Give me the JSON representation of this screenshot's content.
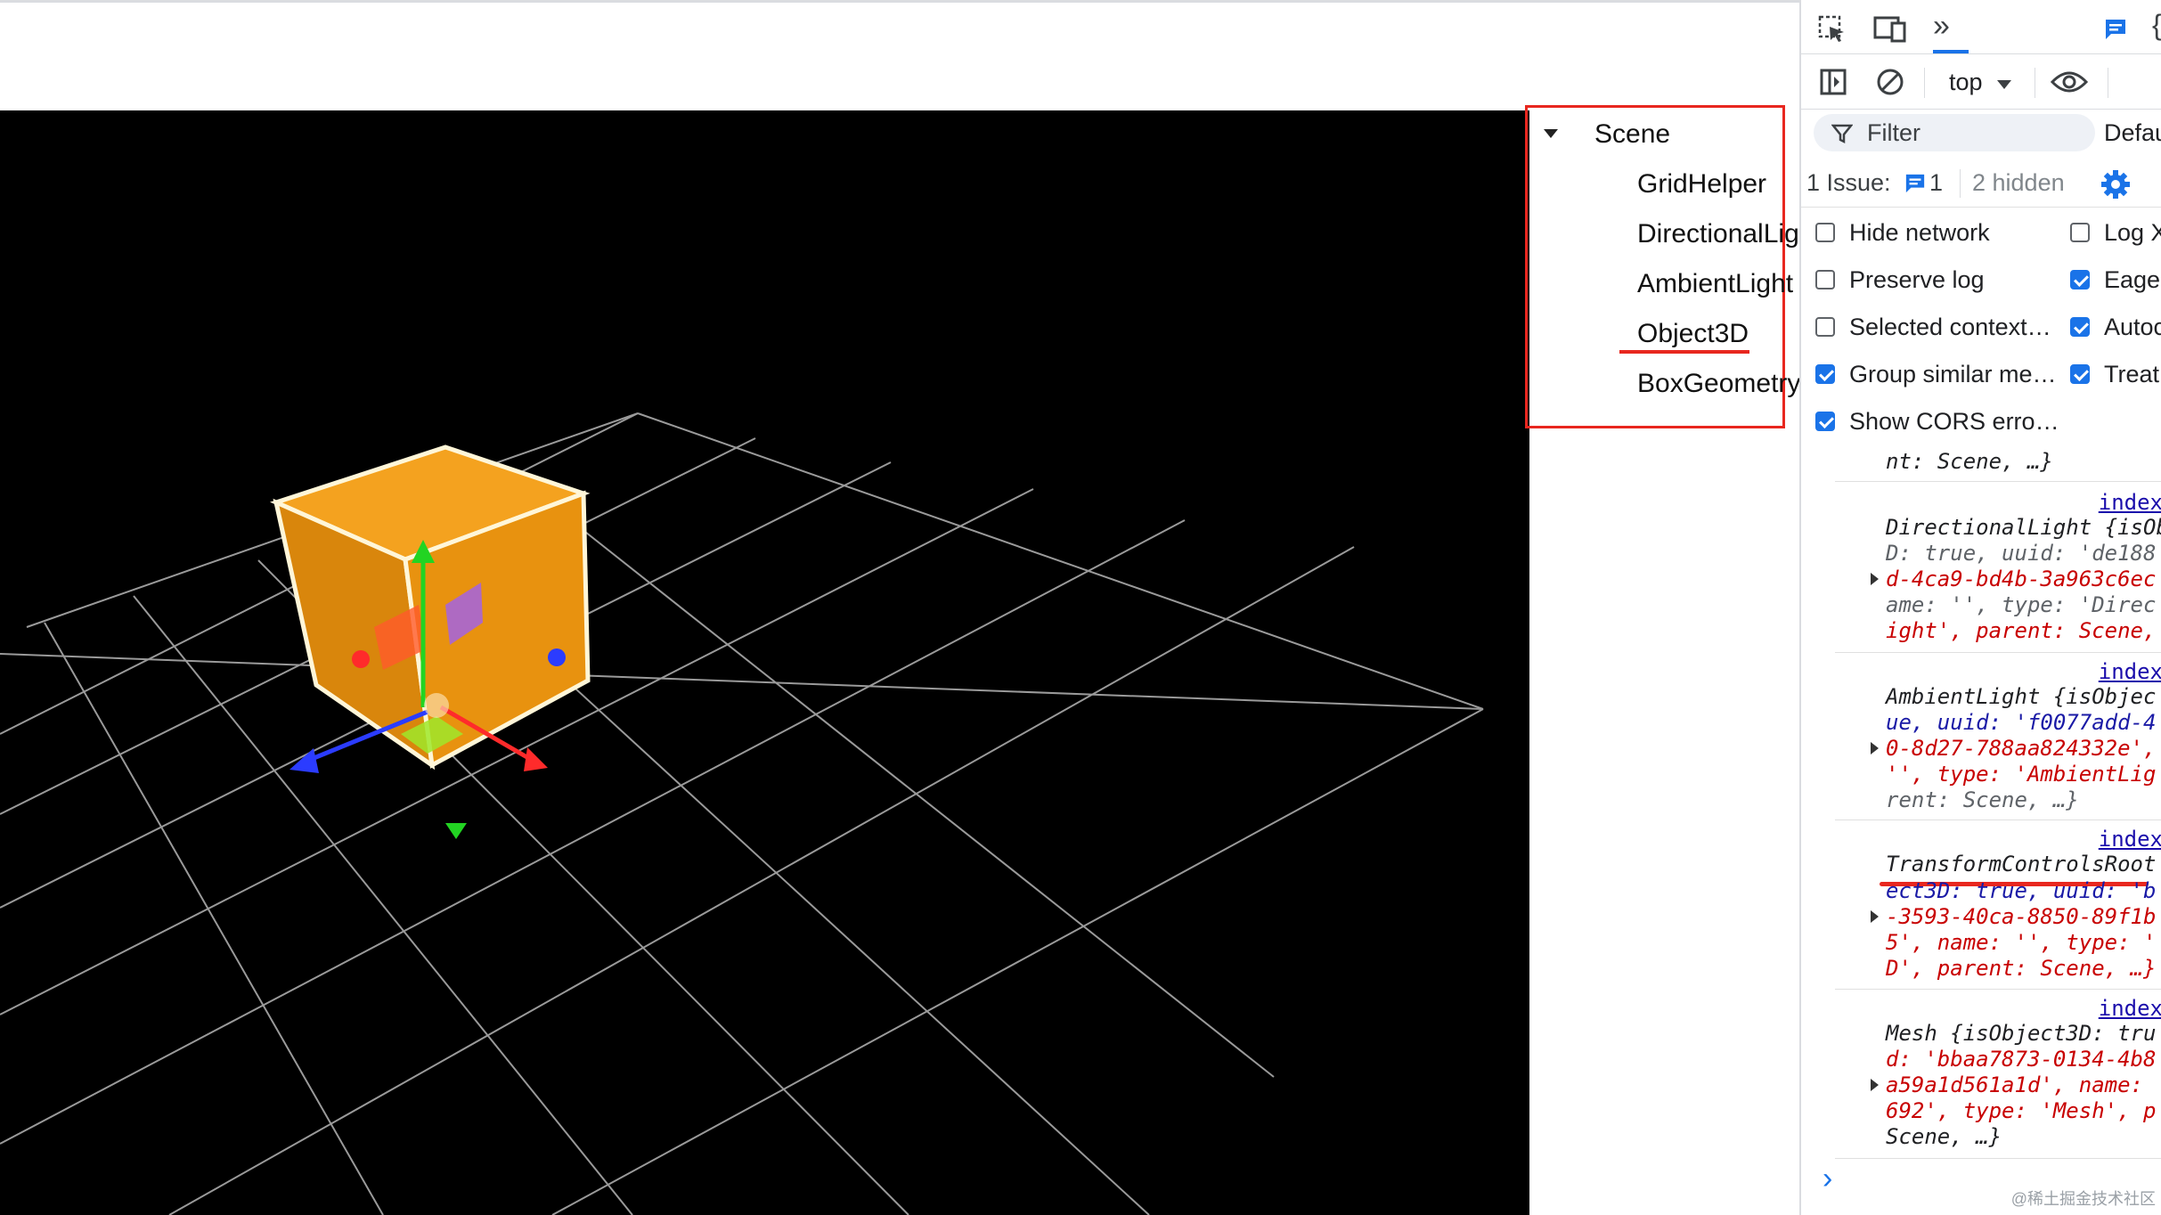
{
  "outliner": {
    "items": [
      {
        "label": "Scene"
      },
      {
        "label": "GridHelper"
      },
      {
        "label": "DirectionalLight"
      },
      {
        "label": "AmbientLight"
      },
      {
        "label": "Object3D"
      },
      {
        "label": "BoxGeometry"
      }
    ],
    "highlight_color": "#e8271f"
  },
  "devtools": {
    "toolbar": {
      "context_label": "top",
      "filter_placeholder": "Filter",
      "levels_label": "Defau"
    },
    "issues": {
      "label": "1 Issue:",
      "count": "1",
      "hidden": "2 hidden"
    },
    "settings_left": [
      {
        "label": "Hide network",
        "checked": false
      },
      {
        "label": "Preserve log",
        "checked": false
      },
      {
        "label": "Selected context…",
        "checked": false
      },
      {
        "label": "Group similar me…",
        "checked": true
      },
      {
        "label": "Show CORS erro…",
        "checked": true
      }
    ],
    "settings_right": [
      {
        "label": "Log X",
        "checked": false
      },
      {
        "label": "Eage",
        "checked": true
      },
      {
        "label": "Autoc",
        "checked": true
      },
      {
        "label": "Treat",
        "checked": true
      }
    ],
    "console": {
      "top_fragment": "nt: Scene, …}",
      "link": "index",
      "entries": [
        {
          "lines": [
            "DirectionalLight {isOb",
            "D: true, uuid: 'de188",
            "d-4ca9-bd4b-3a963c6ec",
            "ame: '', type: 'Direc",
            "ight', parent: Scene,"
          ]
        },
        {
          "lines": [
            "AmbientLight {isObjec",
            "ue, uuid: 'f0077add-4",
            "0-8d27-788aa824332e',",
            "'', type: 'AmbientLig",
            "rent: Scene, …}"
          ]
        },
        {
          "lines": [
            "TransformControlsRoot",
            "ect3D: true, uuid: 'b",
            "-3593-40ca-8850-89f1b",
            "5', name: '', type: '",
            "D', parent: Scene, …}"
          ]
        },
        {
          "lines": [
            "Mesh {isObject3D: tru",
            "d: 'bbaa7873-0134-4b8",
            "a59a1d561a1d', name:",
            "692', type: 'Mesh', p",
            "Scene, …}"
          ]
        }
      ],
      "prompt": "›"
    }
  },
  "watermark": "@稀土掘金技术社区",
  "colors": {
    "accent": "#1a73e8",
    "string": "#c80000",
    "keyword": "#1a1aa6",
    "annotation": "#e8271f",
    "cube": "#e8920f"
  }
}
